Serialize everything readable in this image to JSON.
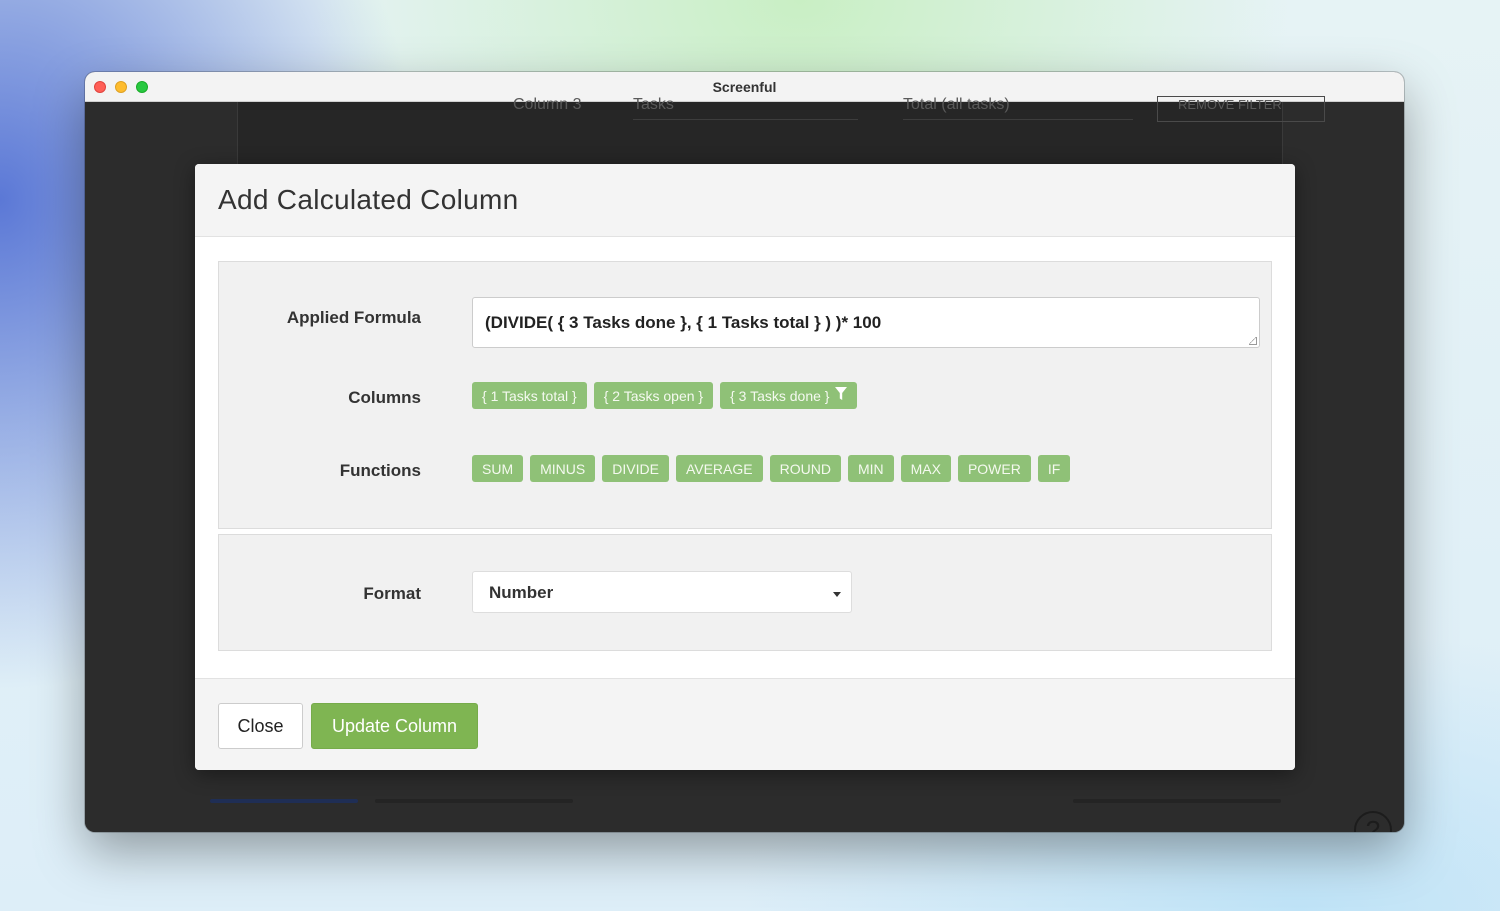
{
  "window": {
    "title": "Screenful"
  },
  "background": {
    "column_label": "Column 3",
    "column_select": "Tasks",
    "aggregate_select": "Total (all tasks)",
    "remove_filter": "REMOVE FILTER",
    "help_glyph": "?"
  },
  "modal": {
    "title": "Add Calculated Column",
    "formula": {
      "label": "Applied Formula",
      "value": "(DIVIDE( { 3 Tasks done },  { 1 Tasks total }  ) )* 100"
    },
    "columns": {
      "label": "Columns",
      "items": [
        "{ 1 Tasks total }",
        "{ 2 Tasks open }",
        "{ 3 Tasks done }"
      ]
    },
    "functions": {
      "label": "Functions",
      "items": [
        "SUM",
        "MINUS",
        "DIVIDE",
        "AVERAGE",
        "ROUND",
        "MIN",
        "MAX",
        "POWER",
        "IF"
      ]
    },
    "format": {
      "label": "Format",
      "value": "Number"
    },
    "footer": {
      "close_label": "Close",
      "update_label": "Update Column"
    }
  },
  "colors": {
    "chip": "#8fc177",
    "primary": "#7fb552"
  },
  "icons": [
    "filter-icon",
    "chevron-down-icon",
    "help-icon",
    "resize-grip-icon"
  ]
}
